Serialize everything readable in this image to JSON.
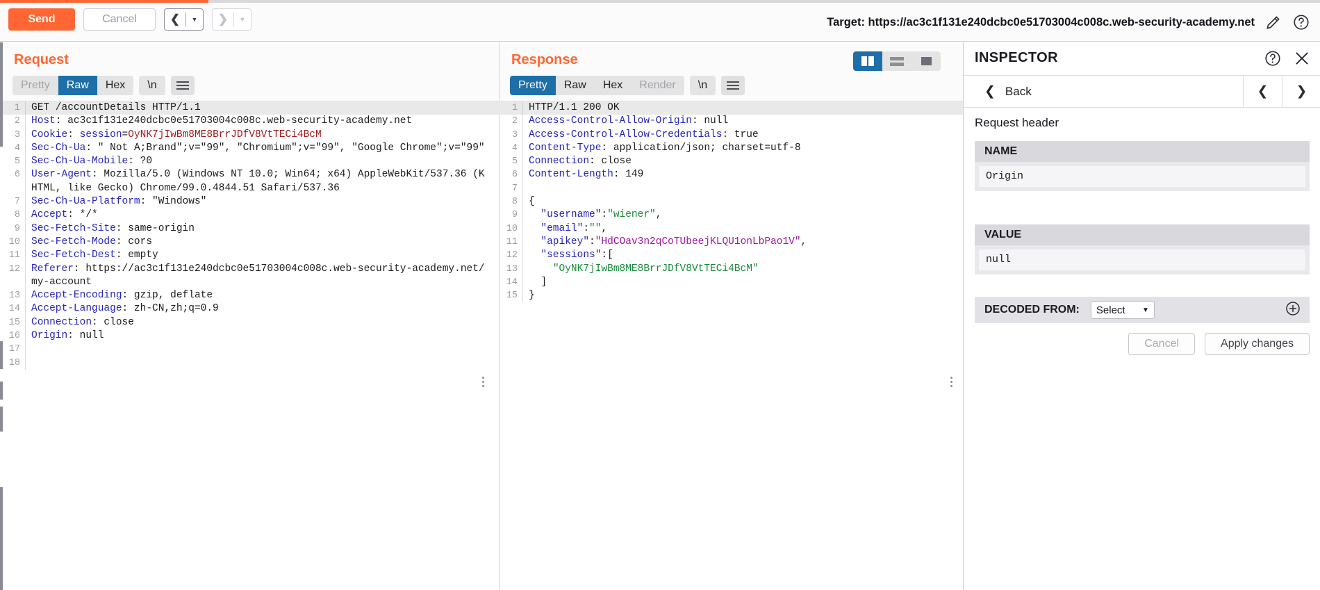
{
  "toolbar": {
    "send_label": "Send",
    "cancel_label": "Cancel",
    "prev_icon": "chevron-left-icon",
    "next_icon": "chevron-right-icon",
    "target_label": "Target: https://ac3c1f131e240dcbc0e51703004c008c.web-security-academy.net",
    "edit_icon": "pencil-icon",
    "help_icon": "question-circle-icon"
  },
  "request": {
    "title": "Request",
    "tabs": [
      "Pretty",
      "Raw",
      "Hex"
    ],
    "active_tab": "Raw",
    "newline_label": "\\n",
    "menu_icon": "hamburger-icon",
    "lines": [
      {
        "n": "1",
        "parts": [
          {
            "t": "GET /accountDetails HTTP/1.1",
            "c": "pl"
          }
        ]
      },
      {
        "n": "2",
        "parts": [
          {
            "t": "Host",
            "c": "hk"
          },
          {
            "t": ": ac3c1f131e240dcbc0e51703004c008c.web-security-academy.net",
            "c": "hv"
          }
        ]
      },
      {
        "n": "3",
        "parts": [
          {
            "t": "Cookie",
            "c": "hk"
          },
          {
            "t": ": ",
            "c": "hv"
          },
          {
            "t": "session",
            "c": "ck"
          },
          {
            "t": "=",
            "c": "hv"
          },
          {
            "t": "OyNK7jIwBm8ME8BrrJDfV8VtTECi4BcM",
            "c": "cv"
          }
        ]
      },
      {
        "n": "4",
        "parts": [
          {
            "t": "Sec-Ch-Ua",
            "c": "hk"
          },
          {
            "t": ": \" Not A;Brand\";v=\"99\", \"Chromium\";v=\"99\", \"Google Chrome\";v=\"99\"",
            "c": "hv"
          }
        ]
      },
      {
        "n": "5",
        "parts": [
          {
            "t": "Sec-Ch-Ua-Mobile",
            "c": "hk"
          },
          {
            "t": ": ?0",
            "c": "hv"
          }
        ]
      },
      {
        "n": "6",
        "parts": [
          {
            "t": "User-Agent",
            "c": "hk"
          },
          {
            "t": ": Mozilla/5.0 (Windows NT 10.0; Win64; x64) AppleWebKit/537.36 (KHTML, like Gecko) Chrome/99.0.4844.51 Safari/537.36",
            "c": "hv"
          }
        ]
      },
      {
        "n": "7",
        "parts": [
          {
            "t": "Sec-Ch-Ua-Platform",
            "c": "hk"
          },
          {
            "t": ": \"Windows\"",
            "c": "hv"
          }
        ]
      },
      {
        "n": "8",
        "parts": [
          {
            "t": "Accept",
            "c": "hk"
          },
          {
            "t": ": */*",
            "c": "hv"
          }
        ]
      },
      {
        "n": "9",
        "parts": [
          {
            "t": "Sec-Fetch-Site",
            "c": "hk"
          },
          {
            "t": ": same-origin",
            "c": "hv"
          }
        ]
      },
      {
        "n": "10",
        "parts": [
          {
            "t": "Sec-Fetch-Mode",
            "c": "hk"
          },
          {
            "t": ": cors",
            "c": "hv"
          }
        ]
      },
      {
        "n": "11",
        "parts": [
          {
            "t": "Sec-Fetch-Dest",
            "c": "hk"
          },
          {
            "t": ": empty",
            "c": "hv"
          }
        ]
      },
      {
        "n": "12",
        "parts": [
          {
            "t": "Referer",
            "c": "hk"
          },
          {
            "t": ": https://ac3c1f131e240dcbc0e51703004c008c.web-security-academy.net/my-account",
            "c": "hv"
          }
        ]
      },
      {
        "n": "13",
        "parts": [
          {
            "t": "Accept-Encoding",
            "c": "hk"
          },
          {
            "t": ": gzip, deflate",
            "c": "hv"
          }
        ]
      },
      {
        "n": "14",
        "parts": [
          {
            "t": "Accept-Language",
            "c": "hk"
          },
          {
            "t": ": zh-CN,zh;q=0.9",
            "c": "hv"
          }
        ]
      },
      {
        "n": "15",
        "parts": [
          {
            "t": "Connection",
            "c": "hk"
          },
          {
            "t": ": close",
            "c": "hv"
          }
        ]
      },
      {
        "n": "16",
        "parts": [
          {
            "t": "Origin",
            "c": "hk"
          },
          {
            "t": ": null",
            "c": "hv"
          }
        ]
      },
      {
        "n": "17",
        "parts": [
          {
            "t": "",
            "c": "pl"
          }
        ]
      },
      {
        "n": "18",
        "parts": [
          {
            "t": "",
            "c": "pl"
          }
        ]
      }
    ]
  },
  "response": {
    "title": "Response",
    "tabs": [
      "Pretty",
      "Raw",
      "Hex",
      "Render"
    ],
    "active_tab": "Pretty",
    "disabled_tab": "Render",
    "newline_label": "\\n",
    "menu_icon": "hamburger-icon",
    "lines": [
      {
        "n": "1",
        "parts": [
          {
            "t": "HTTP/1.1 200 OK",
            "c": "pl"
          }
        ]
      },
      {
        "n": "2",
        "parts": [
          {
            "t": "Access-Control-Allow-Origin",
            "c": "hk"
          },
          {
            "t": ": null",
            "c": "hv"
          }
        ]
      },
      {
        "n": "3",
        "parts": [
          {
            "t": "Access-Control-Allow-Credentials",
            "c": "hk"
          },
          {
            "t": ": true",
            "c": "hv"
          }
        ]
      },
      {
        "n": "4",
        "parts": [
          {
            "t": "Content-Type",
            "c": "hk"
          },
          {
            "t": ": application/json; charset=utf-8",
            "c": "hv"
          }
        ]
      },
      {
        "n": "5",
        "parts": [
          {
            "t": "Connection",
            "c": "hk"
          },
          {
            "t": ": close",
            "c": "hv"
          }
        ]
      },
      {
        "n": "6",
        "parts": [
          {
            "t": "Content-Length",
            "c": "hk"
          },
          {
            "t": ": 149",
            "c": "hv"
          }
        ]
      },
      {
        "n": "7",
        "parts": [
          {
            "t": "",
            "c": "pl"
          }
        ]
      },
      {
        "n": "8",
        "parts": [
          {
            "t": "{",
            "c": "pl"
          }
        ]
      },
      {
        "n": "9",
        "parts": [
          {
            "t": "  \"username\"",
            "c": "jk"
          },
          {
            "t": ":",
            "c": "pl"
          },
          {
            "t": "\"wiener\"",
            "c": "jv"
          },
          {
            "t": ",",
            "c": "pl"
          }
        ]
      },
      {
        "n": "10",
        "parts": [
          {
            "t": "  \"email\"",
            "c": "jk"
          },
          {
            "t": ":",
            "c": "pl"
          },
          {
            "t": "\"\"",
            "c": "jv"
          },
          {
            "t": ",",
            "c": "pl"
          }
        ]
      },
      {
        "n": "11",
        "parts": [
          {
            "t": "  \"apikey\"",
            "c": "jk"
          },
          {
            "t": ":",
            "c": "pl"
          },
          {
            "t": "\"HdCOav3n2qCoTUbeejKLQU1onLbPao1V\"",
            "c": "jp"
          },
          {
            "t": ",",
            "c": "pl"
          }
        ]
      },
      {
        "n": "12",
        "parts": [
          {
            "t": "  \"sessions\"",
            "c": "jk"
          },
          {
            "t": ":[",
            "c": "pl"
          }
        ]
      },
      {
        "n": "13",
        "parts": [
          {
            "t": "    \"OyNK7jIwBm8ME8BrrJDfV8VtTECi4BcM\"",
            "c": "jv"
          }
        ]
      },
      {
        "n": "14",
        "parts": [
          {
            "t": "  ]",
            "c": "pl"
          }
        ]
      },
      {
        "n": "15",
        "parts": [
          {
            "t": "}",
            "c": "pl"
          }
        ]
      }
    ]
  },
  "view_toggle": {
    "options": [
      "side-by-side-icon",
      "stacked-icon",
      "single-icon"
    ],
    "active": "side-by-side-icon"
  },
  "inspector": {
    "title": "INSPECTOR",
    "help_icon": "question-circle-icon",
    "close_icon": "close-x-icon",
    "back_label": "Back",
    "back_icon": "chevron-left-icon",
    "prev_icon": "chevron-left-icon",
    "next_icon": "chevron-right-icon",
    "section_label": "Request header",
    "name_header": "NAME",
    "name_value": "Origin",
    "value_header": "VALUE",
    "value_value": "null",
    "decoded_label": "DECODED FROM:",
    "decoded_select": "Select",
    "decoded_select_icon": "chevron-down-icon",
    "add_icon": "plus-circle-icon",
    "cancel_label": "Cancel",
    "apply_label": "Apply changes"
  },
  "colors": {
    "accent_orange": "#ff6633",
    "active_blue": "#1e6fa8",
    "header_key_blue": "#2525bb",
    "cookie_red": "#a01b1b",
    "json_green": "#1a8a3c",
    "json_purple": "#a015a0"
  }
}
